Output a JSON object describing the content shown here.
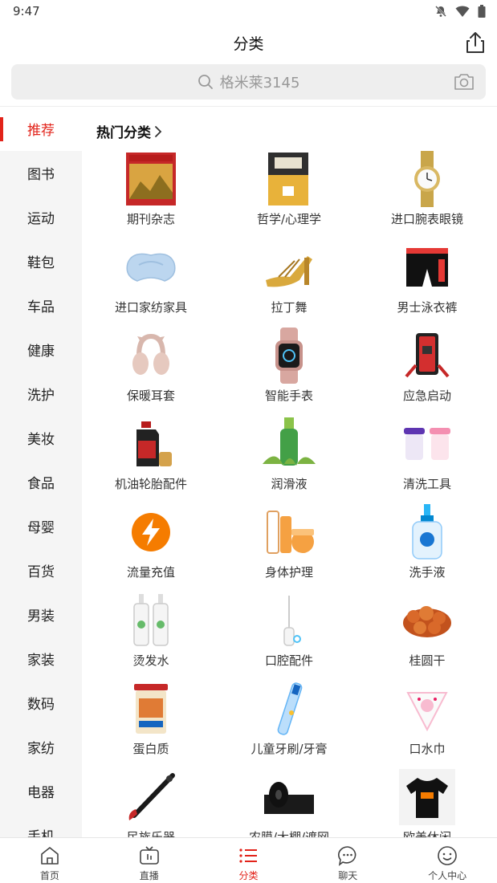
{
  "status_bar": {
    "time": "9:47"
  },
  "header": {
    "title": "分类"
  },
  "search": {
    "placeholder": "格米莱3145"
  },
  "sidebar": {
    "items": [
      {
        "label": "推荐",
        "active": true
      },
      {
        "label": "图书"
      },
      {
        "label": "运动"
      },
      {
        "label": "鞋包"
      },
      {
        "label": "车品"
      },
      {
        "label": "健康"
      },
      {
        "label": "洗护"
      },
      {
        "label": "美妆"
      },
      {
        "label": "食品"
      },
      {
        "label": "母婴"
      },
      {
        "label": "百货"
      },
      {
        "label": "男装"
      },
      {
        "label": "家装"
      },
      {
        "label": "数码"
      },
      {
        "label": "家纺"
      },
      {
        "label": "电器"
      },
      {
        "label": "手机"
      }
    ]
  },
  "section": {
    "title": "热门分类"
  },
  "categories": [
    {
      "label": "期刊杂志",
      "icon": "magazine"
    },
    {
      "label": "哲学/心理学",
      "icon": "book"
    },
    {
      "label": "进口腕表眼镜",
      "icon": "watch"
    },
    {
      "label": "进口家纺家具",
      "icon": "pillow"
    },
    {
      "label": "拉丁舞",
      "icon": "dance-shoe"
    },
    {
      "label": "男士泳衣裤",
      "icon": "swim-trunks"
    },
    {
      "label": "保暖耳套",
      "icon": "earmuffs"
    },
    {
      "label": "智能手表",
      "icon": "smartwatch"
    },
    {
      "label": "应急启动",
      "icon": "jump-starter"
    },
    {
      "label": "机油轮胎配件",
      "icon": "oil-can"
    },
    {
      "label": "润滑液",
      "icon": "lubricant-bottle"
    },
    {
      "label": "清洗工具",
      "icon": "cleaning-cups"
    },
    {
      "label": "流量充值",
      "icon": "lightning"
    },
    {
      "label": "身体护理",
      "icon": "body-care"
    },
    {
      "label": "洗手液",
      "icon": "hand-soap"
    },
    {
      "label": "烫发水",
      "icon": "perm-bottles"
    },
    {
      "label": "口腔配件",
      "icon": "dental-tool"
    },
    {
      "label": "桂圆干",
      "icon": "dried-longan"
    },
    {
      "label": "蛋白质",
      "icon": "protein-can"
    },
    {
      "label": "儿童牙刷/牙膏",
      "icon": "kids-toothbrush"
    },
    {
      "label": "口水巾",
      "icon": "bib"
    },
    {
      "label": "民族乐器",
      "icon": "flute"
    },
    {
      "label": "农膜/大棚/遮网",
      "icon": "film-roll"
    },
    {
      "label": "欧美休闲",
      "icon": "tshirt"
    }
  ],
  "tab_bar": {
    "tabs": [
      {
        "label": "首页"
      },
      {
        "label": "直播"
      },
      {
        "label": "分类",
        "active": true
      },
      {
        "label": "聊天"
      },
      {
        "label": "个人中心"
      }
    ]
  },
  "colors": {
    "accent": "#e2231a"
  }
}
